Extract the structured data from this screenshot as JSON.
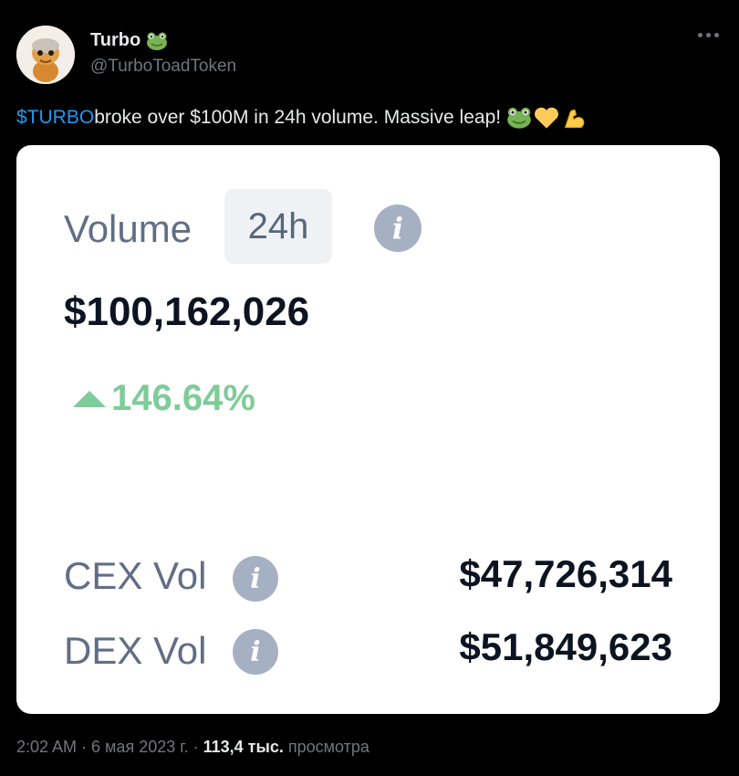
{
  "author": {
    "name": "Turbo",
    "handle": "@TurboToadToken",
    "badge_icon": "frog-emoji-icon"
  },
  "tweet": {
    "cashtag": "$TURBO",
    "text": " broke over $100M in 24h volume. Massive leap!",
    "emojis": [
      "frog-emoji-icon",
      "yellow-heart-emoji-icon",
      "flexed-biceps-emoji-icon"
    ]
  },
  "card": {
    "title": "Volume",
    "period": "24h",
    "total": "$100,162,026",
    "change": "146.64%",
    "change_color": "#7fcb99",
    "rows": [
      {
        "label": "CEX Vol",
        "value": "$47,726,314"
      },
      {
        "label": "DEX Vol",
        "value": "$51,849,623"
      }
    ]
  },
  "meta": {
    "time": "2:02 AM",
    "sep1": " · ",
    "date": "6 мая 2023 г.",
    "sep2": " · ",
    "views_count": "113,4 тыс.",
    "views_label": " просмотра"
  }
}
